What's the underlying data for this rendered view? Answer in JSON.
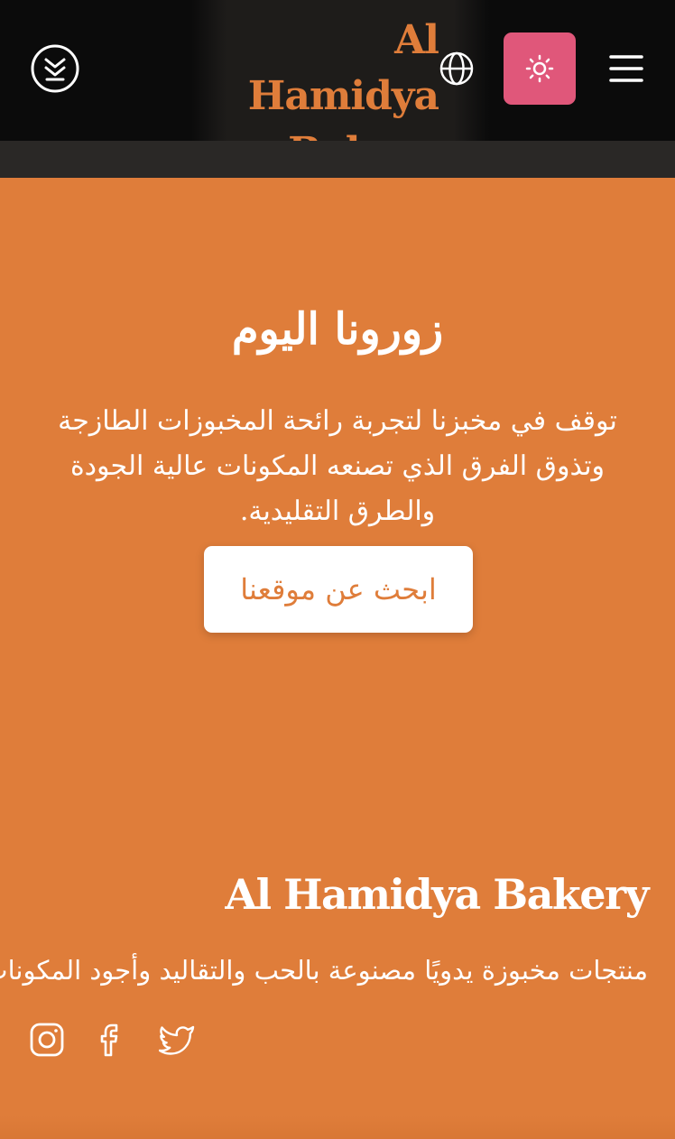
{
  "header": {
    "brand_line1": "Al Hamidya",
    "brand_line2": "Bakery",
    "icons": {
      "scroll": "chevrons-down-circle-icon",
      "language": "globe-icon",
      "theme": "sun-icon",
      "menu": "hamburger-menu-icon"
    }
  },
  "visit": {
    "title": "زورونا اليوم",
    "text": "توقف في مخبزنا لتجربة رائحة المخبوزات الطازجة وتذوق الفرق الذي تصنعه المكونات عالية الجودة والطرق التقليدية.",
    "cta_label": "ابحث عن موقعنا"
  },
  "footer": {
    "brand": "Al Hamidya Bakery",
    "tagline": "منتجات مخبوزة يدويًا مصنوعة بالحب والتقاليد وأجود المكونات.",
    "social": [
      "instagram-icon",
      "facebook-icon",
      "twitter-icon"
    ]
  },
  "colors": {
    "accent": "#DF7D3A",
    "header_bg": "#0B0B0B",
    "theme_button": "#E0577A",
    "text_light": "#FFFFFF"
  }
}
